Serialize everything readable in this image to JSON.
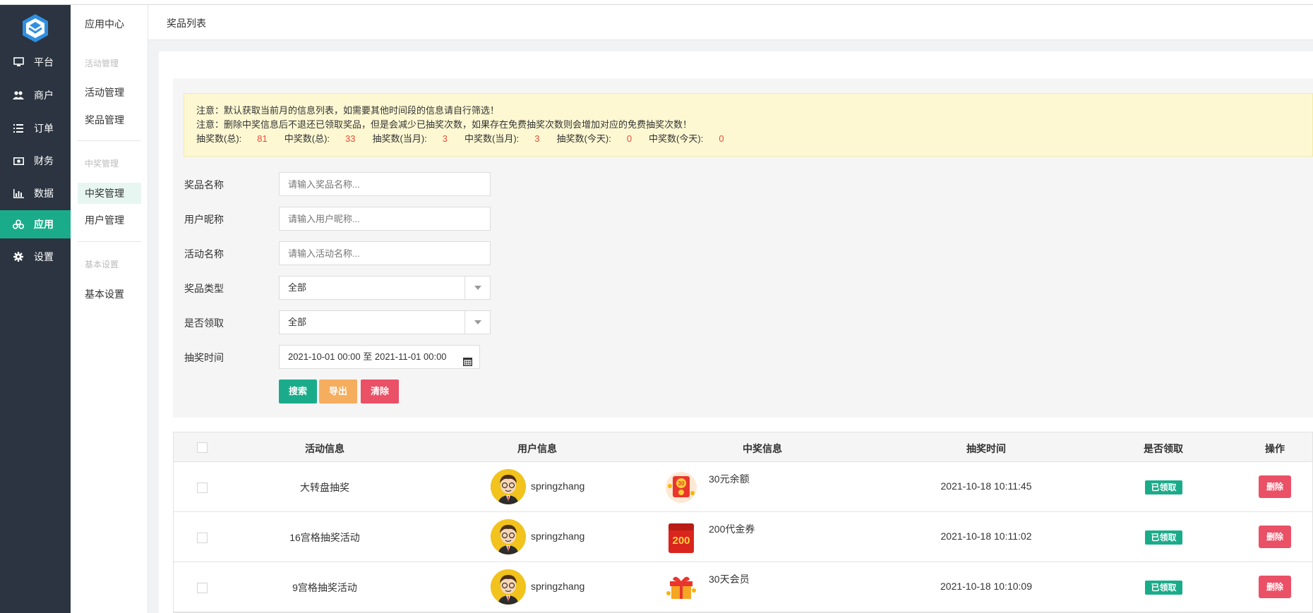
{
  "sidebar": {
    "items": [
      {
        "label": "平台",
        "icon": "monitor-icon"
      },
      {
        "label": "商户",
        "icon": "users-icon"
      },
      {
        "label": "订单",
        "icon": "list-icon"
      },
      {
        "label": "财务",
        "icon": "money-icon"
      },
      {
        "label": "数据",
        "icon": "bar-chart-icon"
      },
      {
        "label": "应用",
        "icon": "apps-icon",
        "active": true
      },
      {
        "label": "设置",
        "icon": "gear-icon"
      }
    ]
  },
  "subnav": {
    "title": "应用中心",
    "groups": [
      {
        "title": "活动管理",
        "items": [
          "活动管理",
          "奖品管理"
        ]
      },
      {
        "title": "中奖管理",
        "items": [
          "中奖管理",
          "用户管理"
        ]
      },
      {
        "title": "基本设置",
        "items": [
          "基本设置"
        ]
      }
    ]
  },
  "header": {
    "title": "奖品列表"
  },
  "notice": {
    "line1": "注意：默认获取当前月的信息列表，如需要其他时间段的信息请自行筛选！",
    "line2": "注意：删除中奖信息后不退还已领取奖品，但是会减少已抽奖次数，如果存在免费抽奖次数则会增加对应的免费抽奖次数！",
    "stats": [
      {
        "label": "抽奖数(总):",
        "value": "81"
      },
      {
        "label": "中奖数(总):",
        "value": "33"
      },
      {
        "label": "抽奖数(当月):",
        "value": "3"
      },
      {
        "label": "中奖数(当月):",
        "value": "3"
      },
      {
        "label": "抽奖数(今天):",
        "value": "0"
      },
      {
        "label": "中奖数(今天):",
        "value": "0"
      }
    ]
  },
  "filters": {
    "prize_name": {
      "label": "奖品名称",
      "placeholder": "请输入奖品名称..."
    },
    "nickname": {
      "label": "用户昵称",
      "placeholder": "请输入用户昵称..."
    },
    "activity": {
      "label": "活动名称",
      "placeholder": "请输入活动名称..."
    },
    "prize_type": {
      "label": "奖品类型",
      "value": "全部"
    },
    "claimed": {
      "label": "是否领取",
      "value": "全部"
    },
    "draw_time": {
      "label": "抽奖时间",
      "value": "2021-10-01 00:00 至 2021-11-01 00:00"
    }
  },
  "buttons": {
    "search": "搜索",
    "export": "导出",
    "clear": "清除"
  },
  "table": {
    "headers": [
      "活动信息",
      "用户信息",
      "中奖信息",
      "抽奖时间",
      "是否领取",
      "操作"
    ],
    "rows": [
      {
        "activity": "大转盘抽奖",
        "user": "springzhang",
        "prize": "30元余额",
        "prize_icon": "cash-30-icon",
        "time": "2021-10-18 10:11:45",
        "status": "已领取",
        "action": "删除"
      },
      {
        "activity": "16宫格抽奖活动",
        "user": "springzhang",
        "prize": "200代金券",
        "prize_icon": "voucher-200-icon",
        "time": "2021-10-18 10:11:02",
        "status": "已领取",
        "action": "删除"
      },
      {
        "activity": "9宫格抽奖活动",
        "user": "springzhang",
        "prize": "30天会员",
        "prize_icon": "vip-gift-icon",
        "time": "2021-10-18 10:10:09",
        "status": "已领取",
        "action": "删除"
      }
    ]
  },
  "colors": {
    "sidebar_bg": "#2b3440",
    "accent": "#1aac8a",
    "danger": "#ea5066",
    "warning": "#f5ad5e",
    "stat_value": "#e84c3d"
  }
}
